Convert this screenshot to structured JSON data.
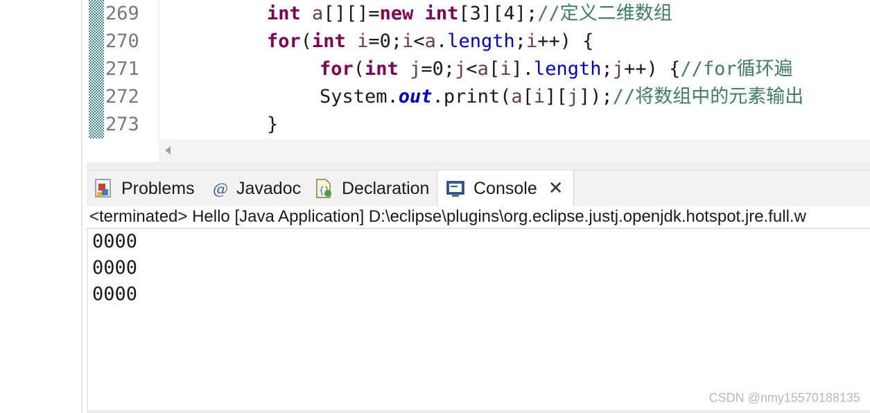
{
  "editor": {
    "line_numbers": [
      "269",
      "270",
      "271",
      "272",
      "273"
    ],
    "lines": [
      [
        {
          "t": "int",
          "c": "kw"
        },
        {
          "t": " ",
          "c": ""
        },
        {
          "t": "a",
          "c": "id"
        },
        {
          "t": "[][]=",
          "c": ""
        },
        {
          "t": "new",
          "c": "kw"
        },
        {
          "t": " ",
          "c": ""
        },
        {
          "t": "int",
          "c": "kw"
        },
        {
          "t": "[3][4];",
          "c": ""
        },
        {
          "t": "//定义二维数组",
          "c": "cm"
        }
      ],
      [
        {
          "t": "for",
          "c": "kw"
        },
        {
          "t": "(",
          "c": ""
        },
        {
          "t": "int",
          "c": "kw"
        },
        {
          "t": " ",
          "c": ""
        },
        {
          "t": "i",
          "c": "id"
        },
        {
          "t": "=0;",
          "c": ""
        },
        {
          "t": "i",
          "c": "id"
        },
        {
          "t": "<",
          "c": ""
        },
        {
          "t": "a",
          "c": "id"
        },
        {
          "t": ".",
          "c": ""
        },
        {
          "t": "length",
          "c": "fld"
        },
        {
          "t": ";",
          "c": ""
        },
        {
          "t": "i",
          "c": "id"
        },
        {
          "t": "++) {",
          "c": ""
        }
      ],
      [
        {
          "t": "for",
          "c": "kw"
        },
        {
          "t": "(",
          "c": ""
        },
        {
          "t": "int",
          "c": "kw"
        },
        {
          "t": " ",
          "c": ""
        },
        {
          "t": "j",
          "c": "id"
        },
        {
          "t": "=0;",
          "c": ""
        },
        {
          "t": "j",
          "c": "id"
        },
        {
          "t": "<",
          "c": ""
        },
        {
          "t": "a",
          "c": "id"
        },
        {
          "t": "[",
          "c": ""
        },
        {
          "t": "i",
          "c": "id"
        },
        {
          "t": "].",
          "c": ""
        },
        {
          "t": "length",
          "c": "fld"
        },
        {
          "t": ";",
          "c": ""
        },
        {
          "t": "j",
          "c": "id"
        },
        {
          "t": "++) {",
          "c": ""
        },
        {
          "t": "//for循环遍",
          "c": "cm"
        }
      ],
      [
        {
          "t": "System.",
          "c": ""
        },
        {
          "t": "out",
          "c": "fld-it"
        },
        {
          "t": ".print(",
          "c": ""
        },
        {
          "t": "a",
          "c": "id"
        },
        {
          "t": "[",
          "c": ""
        },
        {
          "t": "i",
          "c": "id"
        },
        {
          "t": "][",
          "c": ""
        },
        {
          "t": "j",
          "c": "id"
        },
        {
          "t": "]);",
          "c": ""
        },
        {
          "t": "//将数组中的元素输出",
          "c": "cm"
        }
      ],
      [
        {
          "t": "}",
          "c": ""
        }
      ]
    ]
  },
  "tabs": [
    {
      "label": "Problems",
      "icon": "problems-icon"
    },
    {
      "label": "Javadoc",
      "icon": "javadoc-icon"
    },
    {
      "label": "Declaration",
      "icon": "declaration-icon"
    },
    {
      "label": "Console",
      "icon": "console-icon",
      "active": true
    }
  ],
  "console": {
    "header": "<terminated> Hello [Java Application] D:\\eclipse\\plugins\\org.eclipse.justj.openjdk.hotspot.jre.full.w",
    "output": [
      "0000",
      "0000",
      "0000"
    ]
  },
  "watermark": "CSDN @nmy15570188135",
  "colors": {
    "keyword": "#7f0055",
    "field": "#0000c0",
    "comment": "#3f7f5f",
    "variable": "#6a3e3e"
  }
}
